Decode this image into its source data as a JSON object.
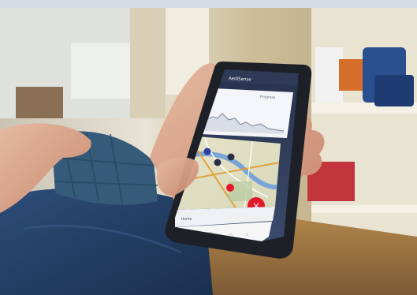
{
  "photo": {
    "subject": "hand holding smartphone showing a chart and a map"
  },
  "app": {
    "header_title": "AediSense",
    "chart_badge": "Progress"
  },
  "bottom_nav": {
    "items": [
      {
        "label": "Home"
      },
      {
        "label": ""
      },
      {
        "label": ""
      }
    ]
  },
  "colors": {
    "accent": "#e0192b",
    "header": "#2e3a56"
  }
}
